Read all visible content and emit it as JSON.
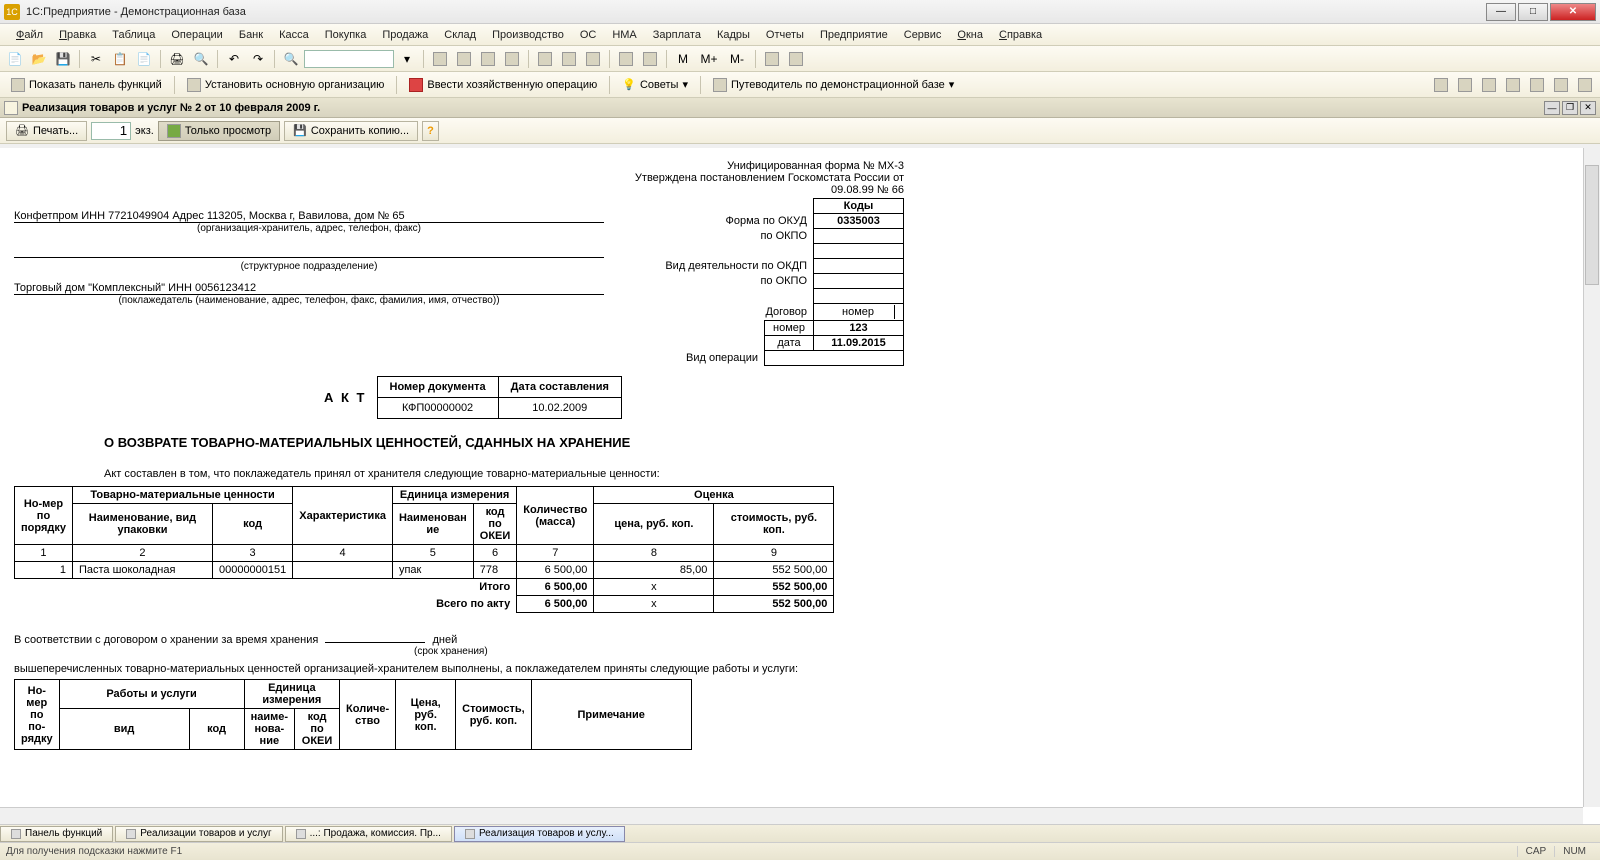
{
  "titlebar": {
    "title": "1С:Предприятие - Демонстрационная база"
  },
  "menu": [
    "Файл",
    "Правка",
    "Таблица",
    "Операции",
    "Банк",
    "Касса",
    "Покупка",
    "Продажа",
    "Склад",
    "Производство",
    "ОС",
    "НМА",
    "Зарплата",
    "Кадры",
    "Отчеты",
    "Предприятие",
    "Сервис",
    "Окна",
    "Справка"
  ],
  "menu_ul": [
    "Ф",
    "П",
    "",
    "",
    "",
    "",
    "",
    "",
    "",
    "",
    "",
    "",
    "",
    "",
    "",
    "",
    "",
    "О",
    "С"
  ],
  "toolbar1": {
    "mplus": "M+",
    "mminus": "M-",
    "m": "M"
  },
  "toolbar2": {
    "show_panel": "Показать панель функций",
    "set_org": "Установить основную организацию",
    "enter_op": "Ввести хозяйственную операцию",
    "advice": "Советы",
    "guide": "Путеводитель по демонстрационной базе"
  },
  "subtitle": "Реализация товаров и услуг № 2 от 10 февраля 2009 г.",
  "printbar": {
    "print": "Печать...",
    "copies": "1",
    "copies_suffix": "экз.",
    "view_only": "Только просмотр",
    "save_copy": "Сохранить копию..."
  },
  "doc": {
    "form_line1": "Унифицированная форма № МХ-3",
    "form_line2": "Утверждена постановлением Госкомстата России от 09.08.99 № 66",
    "codes_hdr": "Коды",
    "okud_lbl": "Форма по ОКУД",
    "okud_val": "0335003",
    "okpo_lbl": "по ОКПО",
    "okdp_lbl": "Вид деятельности по ОКДП",
    "dogovor_lbl": "Договор",
    "nomer_lbl": "номер",
    "nomer_val": "123",
    "data_lbl": "дата",
    "data_val": "11.09.2015",
    "vidop_lbl": "Вид операции",
    "org_line": "Конфетпром ИНН 7721049904 Адрес 113205, Москва г, Вавилова, дом № 65",
    "org_sub": "(организация-хранитель, адрес, телефон, факс)",
    "struct_sub": "(структурное подразделение)",
    "depositor": "Торговый дом \"Комплексный\" ИНН 0056123412",
    "depositor_sub": "(поклажедатель (наименование, адрес, телефон, факс, фамилия, имя, отчество))",
    "akt": "А К Т",
    "docnum_lbl": "Номер документа",
    "docdate_lbl": "Дата составления",
    "docnum": "КФП00000002",
    "docdate": "10.02.2009",
    "heading": "О ВОЗВРАТЕ ТОВАРНО-МАТЕРИАЛЬНЫХ ЦЕННОСТЕЙ, СДАННЫХ НА ХРАНЕНИЕ",
    "intro": "Акт составлен в том, что поклажедатель принял от хранителя следующие товарно-материальные ценности:",
    "th": {
      "num": "Но-мер по порядку",
      "tmc": "Товарно-материальные ценности",
      "name": "Наименование, вид упаковки",
      "code": "код",
      "char": "Характеристика",
      "unit": "Единица измерения",
      "uname": "Наименован ие",
      "okei": "код по ОКЕИ",
      "qty": "Количество (масса)",
      "eval": "Оценка",
      "price": "цена,        руб. коп.",
      "sum": "стоимость, руб. коп."
    },
    "colnums": [
      "1",
      "2",
      "3",
      "4",
      "5",
      "6",
      "7",
      "8",
      "9"
    ],
    "row": {
      "n": "1",
      "name": "Паста шоколадная",
      "code": "00000000151",
      "char": "",
      "uname": "упак",
      "okei": "778",
      "qty": "6 500,00",
      "price": "85,00",
      "sum": "552 500,00"
    },
    "itogo": "Итого",
    "itogo_qty": "6 500,00",
    "itogo_price": "х",
    "itogo_sum": "552 500,00",
    "vsego": "Всего по акту",
    "vsego_qty": "6 500,00",
    "vsego_price": "х",
    "vsego_sum": "552 500,00",
    "contract_line": "В соответствии с договором о хранении за время хранения",
    "days": "дней",
    "srok": "(срок хранения)",
    "services_line": "вышеперечисленных товарно-материальных ценностей организацией-хранителем выполнены, а поклажедателем приняты следующие работы и услуги:",
    "th2": {
      "num": "Но-мер по по-рядку",
      "works": "Работы и услуги",
      "vid": "вид",
      "code": "код",
      "unit": "Единица измерения",
      "uname": "наиме-нова-ние",
      "okei": "код по ОКЕИ",
      "qty": "Количе-ство",
      "price": "Цена, руб. коп.",
      "sum": "Стоимость, руб. коп.",
      "note": "Примечание"
    }
  },
  "tabs": [
    "Панель функций",
    "Реализации товаров и услуг",
    "...: Продажа, комиссия. Пр...",
    "Реализация товаров и услу..."
  ],
  "status": {
    "hint": "Для получения подсказки нажмите F1",
    "cap": "CAP",
    "num": "NUM"
  }
}
